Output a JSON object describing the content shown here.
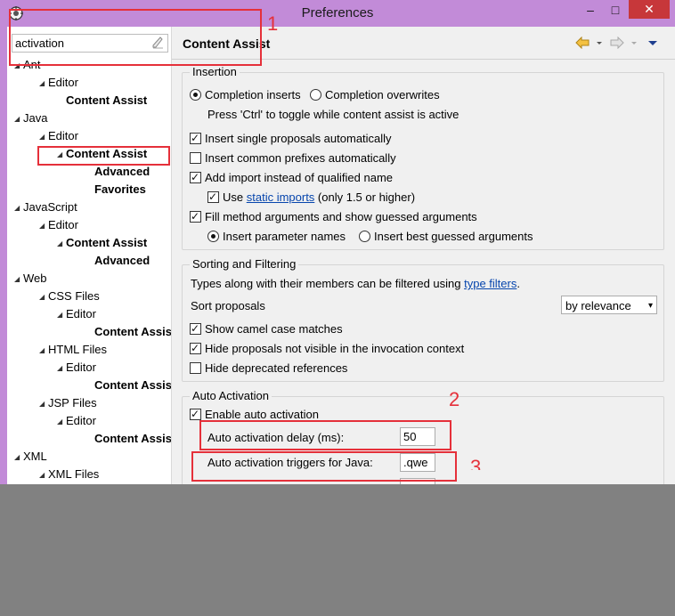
{
  "window": {
    "title": "Preferences",
    "close_glyph": "✕",
    "minimize_glyph": "–",
    "maximize_glyph": "□"
  },
  "filter": {
    "value": "activation"
  },
  "tree": [
    {
      "label": "Ant",
      "bold": false,
      "level": 0,
      "expanded": true
    },
    {
      "label": "Editor",
      "bold": false,
      "level": 1,
      "expanded": true
    },
    {
      "label": "Content Assist",
      "bold": true,
      "level": 2,
      "expanded": false
    },
    {
      "label": "Java",
      "bold": false,
      "level": 0,
      "expanded": true
    },
    {
      "label": "Editor",
      "bold": false,
      "level": 1,
      "expanded": true
    },
    {
      "label": "Content Assist",
      "bold": true,
      "level": 2,
      "expanded": true,
      "selected": true
    },
    {
      "label": "Advanced",
      "bold": true,
      "level": 3,
      "expanded": false
    },
    {
      "label": "Favorites",
      "bold": true,
      "level": 3,
      "expanded": false
    },
    {
      "label": "JavaScript",
      "bold": false,
      "level": 0,
      "expanded": true
    },
    {
      "label": "Editor",
      "bold": false,
      "level": 1,
      "expanded": true
    },
    {
      "label": "Content Assist",
      "bold": true,
      "level": 2,
      "expanded": true
    },
    {
      "label": "Advanced",
      "bold": true,
      "level": 3,
      "expanded": false
    },
    {
      "label": "Web",
      "bold": false,
      "level": 0,
      "expanded": true
    },
    {
      "label": "CSS Files",
      "bold": false,
      "level": 1,
      "expanded": true
    },
    {
      "label": "Editor",
      "bold": false,
      "level": 2,
      "expanded": true
    },
    {
      "label": "Content Assist",
      "bold": true,
      "level": 3,
      "expanded": false
    },
    {
      "label": "HTML Files",
      "bold": false,
      "level": 1,
      "expanded": true
    },
    {
      "label": "Editor",
      "bold": false,
      "level": 2,
      "expanded": true
    },
    {
      "label": "Content Assist",
      "bold": true,
      "level": 3,
      "expanded": false
    },
    {
      "label": "JSP Files",
      "bold": false,
      "level": 1,
      "expanded": true
    },
    {
      "label": "Editor",
      "bold": false,
      "level": 2,
      "expanded": true
    },
    {
      "label": "Content Assist",
      "bold": true,
      "level": 3,
      "expanded": false
    },
    {
      "label": "XML",
      "bold": false,
      "level": 0,
      "expanded": true
    },
    {
      "label": "XML Files",
      "bold": false,
      "level": 1,
      "expanded": true
    }
  ],
  "page": {
    "title": "Content Assist",
    "insertion": {
      "label": "Insertion",
      "radio_inserts": "Completion inserts",
      "radio_overwrites": "Completion overwrites",
      "toggle_hint": "Press 'Ctrl' to toggle while content assist is active",
      "insert_single": "Insert single proposals automatically",
      "insert_prefixes": "Insert common prefixes automatically",
      "add_import": "Add import instead of qualified name",
      "use_prefix": "Use ",
      "static_imports": "static imports",
      "use_suffix": " (only 1.5 or higher)",
      "fill_args": "Fill method arguments and show guessed arguments",
      "radio_param_names": "Insert parameter names",
      "radio_guessed": "Insert best guessed arguments"
    },
    "sorting": {
      "label": "Sorting and Filtering",
      "desc_prefix": "Types along with their members can be filtered using ",
      "type_filters": "type filters",
      "desc_suffix": ".",
      "sort_label": "Sort proposals",
      "sort_value": "by relevance",
      "camel_case": "Show camel case matches",
      "hide_not_visible": "Hide proposals not visible in the invocation context",
      "hide_deprecated": "Hide deprecated references"
    },
    "auto": {
      "label": "Auto Activation",
      "enable": "Enable auto activation",
      "delay_label": "Auto activation delay (ms):",
      "delay_value": "50",
      "triggers_label": "Auto activation triggers for Java:",
      "triggers_value": ".qwe"
    }
  },
  "annotations": {
    "one": "1",
    "two": "2",
    "three": "3"
  },
  "colors": {
    "annotation": "#e5303a",
    "title_bar": "#c28bd8",
    "close": "#c7373a",
    "link": "#0645ad"
  }
}
